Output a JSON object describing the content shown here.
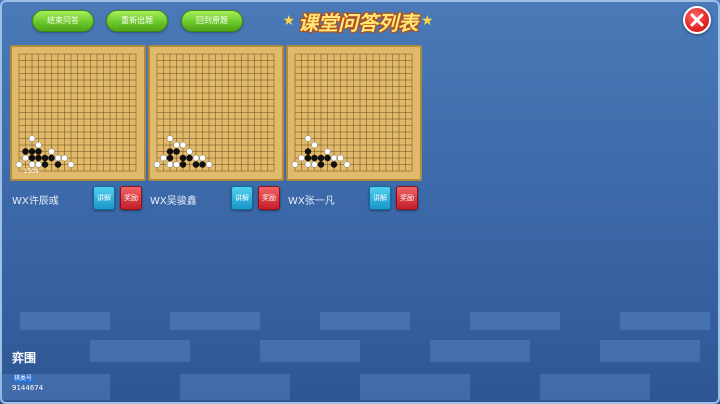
{
  "header": {
    "buttons": [
      {
        "label": "结束问答"
      },
      {
        "label": "重新出题"
      },
      {
        "label": "回到原题"
      }
    ],
    "title": "课堂问答列表",
    "title_star": "★"
  },
  "students": [
    {
      "name": "WX许辰彧",
      "explain_label": "讲解",
      "reward_label": "奖励"
    },
    {
      "name": "WX吴骏鑫",
      "explain_label": "讲解",
      "reward_label": "奖励"
    },
    {
      "name": "WX张一凡",
      "explain_label": "讲解",
      "reward_label": "奖励"
    }
  ],
  "board_label": "1509",
  "logo": {
    "main": "弈围",
    "sub": "棋类号",
    "number": "9144674"
  },
  "colors": {
    "background": "#3d6aaa",
    "board": "#e0b96a",
    "green_button": "#6cc92a",
    "title": "#ffe87a",
    "close": "#e22626"
  }
}
